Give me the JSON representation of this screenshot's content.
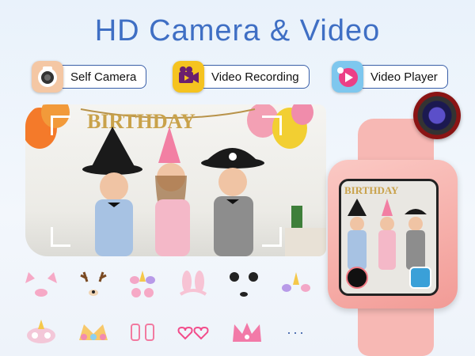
{
  "title": "HD Camera & Video",
  "features": [
    {
      "label": "Self Camera",
      "icon": "camera-icon"
    },
    {
      "label": "Video Recording",
      "icon": "video-camera-icon"
    },
    {
      "label": "Video Player",
      "icon": "play-icon"
    }
  ],
  "photo": {
    "banner_text": "BIRTHDAY"
  },
  "watch": {
    "banner_text": "BIRTHDAY"
  },
  "stickers_more": "···",
  "colors": {
    "title": "#3f6fc4",
    "pill_border": "#3a5fa8",
    "watch_pink": "#f7b8b4"
  }
}
